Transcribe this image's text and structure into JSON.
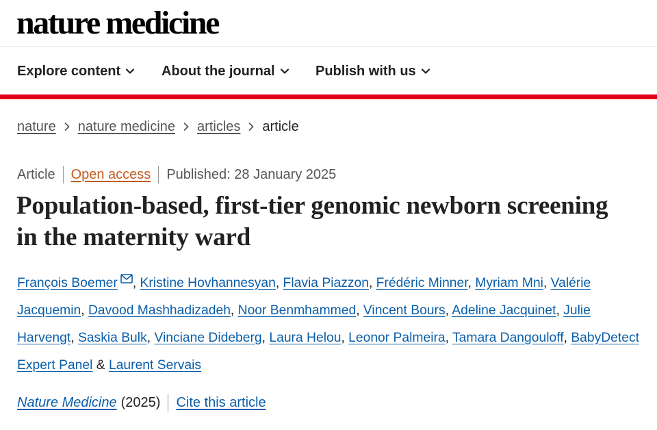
{
  "brand": {
    "logo_text": "nature medicine"
  },
  "nav": {
    "items": [
      {
        "label": "Explore content",
        "icon": "chevron-down-icon"
      },
      {
        "label": "About the journal",
        "icon": "chevron-down-icon"
      },
      {
        "label": "Publish with us",
        "icon": "chevron-down-icon"
      }
    ]
  },
  "colors": {
    "accent_rule": "#e0001b",
    "link": "#0b5ea8",
    "open_access": "#c25a1b"
  },
  "breadcrumb": {
    "items": [
      "nature",
      "nature medicine",
      "articles"
    ],
    "current": "article",
    "separator_icon": "chevron-right-icon"
  },
  "article": {
    "type": "Article",
    "access": "Open access",
    "published": "Published: 28 January 2025",
    "title": "Population-based, first-tier genomic newborn screening in the maternity ward",
    "authors": [
      "François Boemer",
      "Kristine Hovhannesyan",
      "Flavia Piazzon",
      "Frédéric Minner",
      "Myriam Mni",
      "Valérie Jacquemin",
      "Davood Mashhadizadeh",
      "Noor Benmhammed",
      "Vincent Bours",
      "Adeline Jacquinet",
      "Julie Harvengt",
      "Saskia Bulk",
      "Vinciane Dideberg",
      "Laura Helou",
      "Leonor Palmeira",
      "Tamara Dangouloff",
      "BabyDetect Expert Panel",
      "Laurent Servais"
    ],
    "separator": ", ",
    "last_separator": " & ",
    "corresponding_icon": "mail-icon",
    "journal": "Nature Medicine",
    "year": "(2025)",
    "cite_label": "Cite this article"
  }
}
